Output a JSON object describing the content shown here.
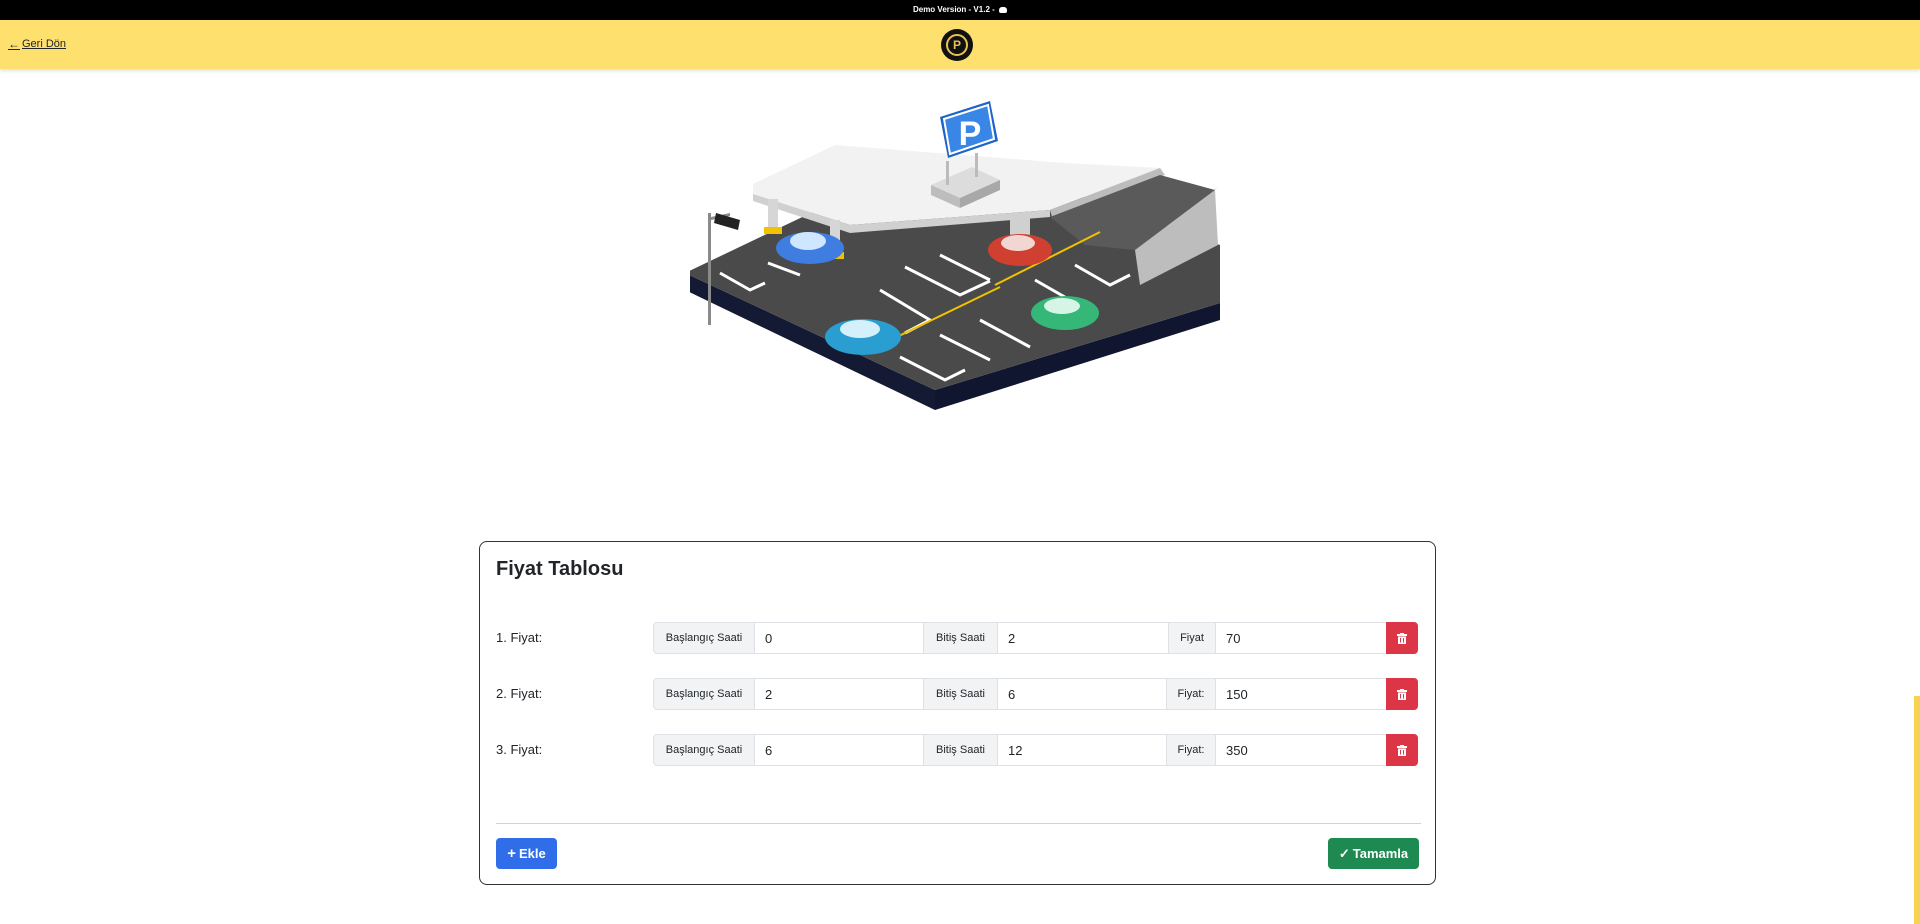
{
  "topbar": {
    "text": "Demo Version - V1.2 -",
    "icon": "discord-icon"
  },
  "header": {
    "back_label": "Geri Dön",
    "back_icon": "arrow-left-icon",
    "logo_letter": "P",
    "logo_icon": "parking-logo-icon"
  },
  "illustration": {
    "sign_letter": "P"
  },
  "price_table": {
    "title": "Fiyat Tablosu",
    "rows": [
      {
        "label": "1. Fiyat:",
        "start_label": "Başlangıç Saati",
        "start": "0",
        "end_label": "Bitiş Saati",
        "end": "2",
        "price_label": "Fiyat",
        "price": "70"
      },
      {
        "label": "2. Fiyat:",
        "start_label": "Başlangıç Saati",
        "start": "2",
        "end_label": "Bitiş Saati",
        "end": "6",
        "price_label": "Fiyat:",
        "price": "150"
      },
      {
        "label": "3. Fiyat:",
        "start_label": "Başlangıç Saati",
        "start": "6",
        "end_label": "Bitiş Saati",
        "end": "12",
        "price_label": "Fiyat:",
        "price": "350"
      }
    ],
    "add_label": "Ekle",
    "done_label": "Tamamla"
  },
  "colors": {
    "header": "#fde06e",
    "add": "#2f6ee8",
    "done": "#1e8a52",
    "delete": "#dc3545"
  }
}
